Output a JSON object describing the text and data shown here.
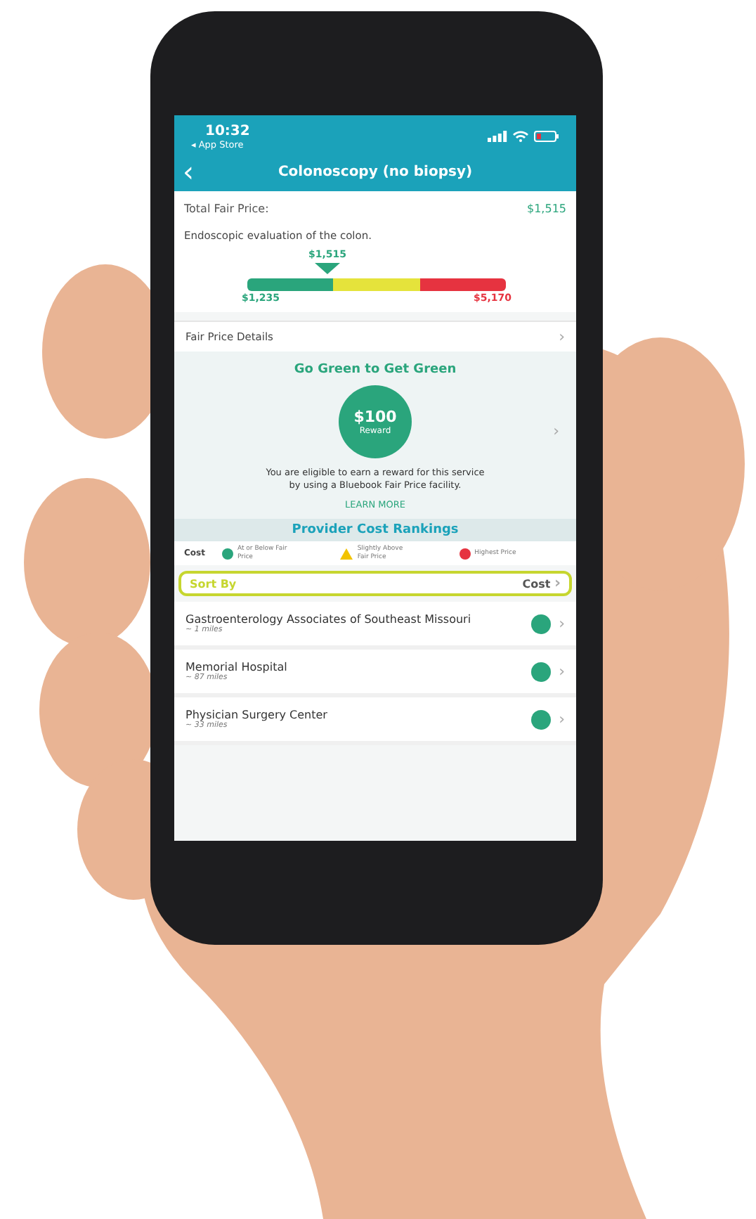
{
  "status_bar": {
    "time": "10:32",
    "back_app": "◂ App Store"
  },
  "nav": {
    "back": "‹",
    "title": "Colonoscopy (no biopsy)"
  },
  "price": {
    "label": "Total Fair Price:",
    "value": "$1,515",
    "description": "Endoscopic evaluation of the colon.",
    "marker": "$1,515",
    "level": 0.31,
    "low": "$1,235",
    "high": "$5,170"
  },
  "details": {
    "label": "Fair Price Details",
    "chevron": "›"
  },
  "reward": {
    "title": "Go Green to Get Green",
    "amount": "$100",
    "amount_label": "Reward",
    "text": "You are eligible to earn a reward for this service by using a Bluebook Fair Price facility.",
    "link": "LEARN MORE",
    "chevron": "›"
  },
  "rankings": {
    "title": "Provider Cost Rankings",
    "legend_title": "Cost",
    "legend": [
      {
        "kind": "circle",
        "color": "#2aa57c",
        "label": "At or Below Fair Price"
      },
      {
        "kind": "triangle",
        "color": "#f2c300",
        "label": "Slightly Above Fair Price"
      },
      {
        "kind": "circle",
        "color": "#e63340",
        "label": "Highest Price"
      }
    ],
    "sort": {
      "label": "Sort By",
      "value": "Cost",
      "chevron": "›"
    },
    "providers": [
      {
        "name": "Gastroenterology Associates of Southeast Missouri",
        "distance": "~ 1 miles",
        "color": "#2aa57c",
        "chevron": "›"
      },
      {
        "name": "Memorial Hospital",
        "distance": "~ 87 miles",
        "color": "#2aa57c",
        "chevron": "›"
      },
      {
        "name": "Physician Surgery Center",
        "distance": "~ 33 miles",
        "color": "#2aa57c",
        "chevron": "›"
      }
    ]
  }
}
